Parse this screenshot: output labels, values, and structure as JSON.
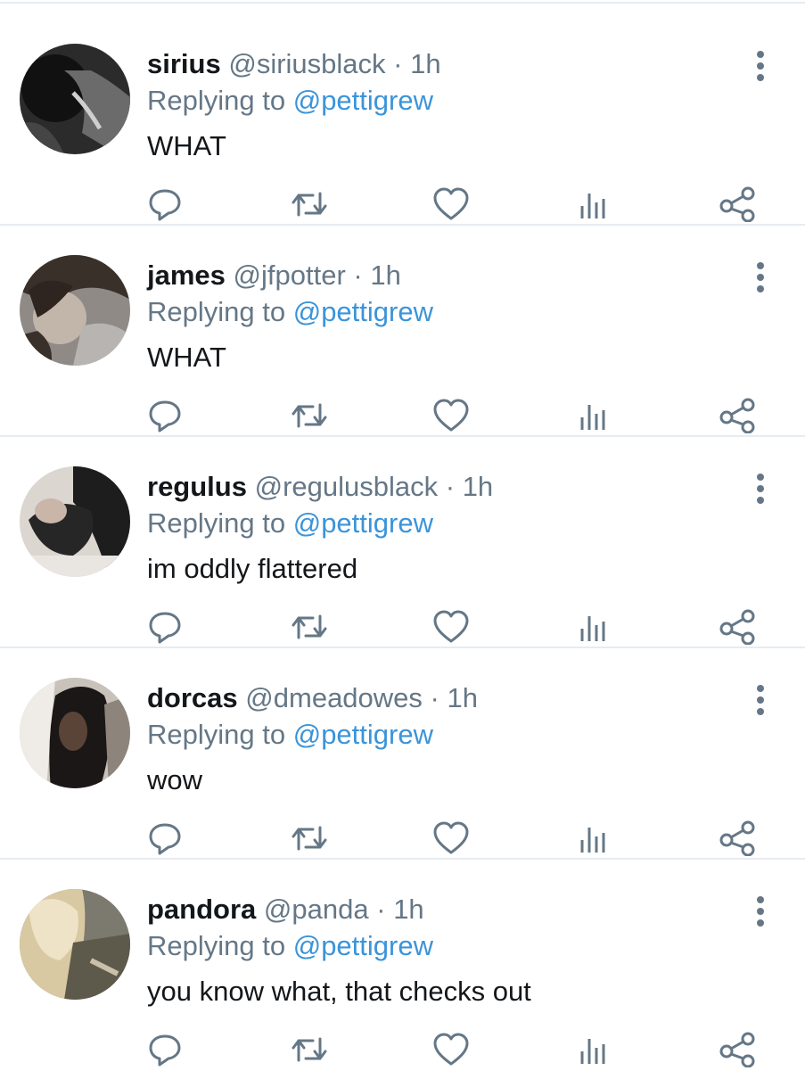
{
  "reply_label": "Replying to",
  "colors": {
    "link": "#3b94d9",
    "secondary": "#657786",
    "divider": "#e6ecf0"
  },
  "icons": [
    "reply-icon",
    "retweet-icon",
    "like-icon",
    "analytics-icon",
    "share-icon",
    "more-icon"
  ],
  "tweets": [
    {
      "name": "sirius",
      "handle": "@siriusblack",
      "sep": "·",
      "time": "1h",
      "reply_to": "@pettigrew",
      "text": "WHAT"
    },
    {
      "name": "james",
      "handle": "@jfpotter",
      "sep": "·",
      "time": "1h",
      "reply_to": "@pettigrew",
      "text": "WHAT"
    },
    {
      "name": "regulus",
      "handle": "@regulusblack",
      "sep": "·",
      "time": "1h",
      "reply_to": "@pettigrew",
      "text": "im oddly flattered"
    },
    {
      "name": "dorcas",
      "handle": "@dmeadowes",
      "sep": "·",
      "time": "1h",
      "reply_to": "@pettigrew",
      "text": "wow"
    },
    {
      "name": "pandora",
      "handle": "@panda",
      "sep": "·",
      "time": "1h",
      "reply_to": "@pettigrew",
      "text": "you know what, that checks out"
    }
  ]
}
